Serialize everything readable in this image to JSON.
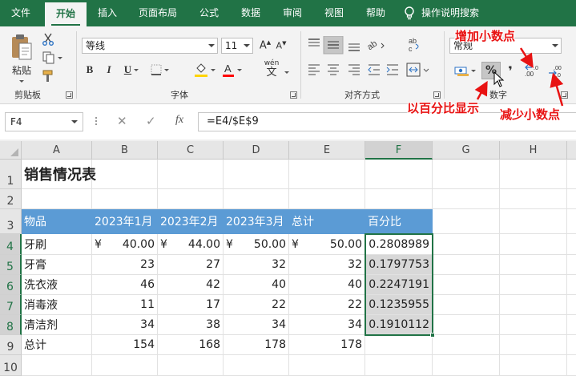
{
  "menu": {
    "tabs": [
      "文件",
      "开始",
      "插入",
      "页面布局",
      "公式",
      "数据",
      "审阅",
      "视图",
      "帮助"
    ],
    "active_tab": "开始",
    "tell_me": "操作说明搜索"
  },
  "ribbon": {
    "clipboard": {
      "paste_label": "粘贴",
      "group_label": "剪贴板"
    },
    "font": {
      "font_name": "等线",
      "font_size": "11",
      "wen_label": "wén",
      "group_label": "字体"
    },
    "alignment": {
      "group_label": "对齐方式"
    },
    "number": {
      "format": "常规",
      "percent_symbol": "%",
      "comma_symbol": "❜",
      "group_label": "数字"
    }
  },
  "annotations": {
    "increase_decimal": "增加小数点",
    "percent_style": "以百分比显示",
    "decrease_decimal": "减少小数点",
    "color": "#e81212"
  },
  "formula_bar": {
    "name_box": "F4",
    "cancel": "✕",
    "enter": "✓",
    "fx": "fx",
    "formula": "=E4/$E$9"
  },
  "sheet": {
    "columns": [
      "A",
      "B",
      "C",
      "D",
      "E",
      "F",
      "G",
      "H"
    ],
    "rows": [
      "1",
      "2",
      "3",
      "4",
      "5",
      "6",
      "7",
      "8",
      "9",
      "10"
    ],
    "title": "销售情况表",
    "headers": [
      "物品",
      "2023年1月",
      "2023年2月",
      "2023年3月",
      "总计",
      "百分比"
    ],
    "currency_symbol": "¥",
    "data": [
      {
        "item": "牙刷",
        "jan": "40.00",
        "feb": "44.00",
        "mar": "50.00",
        "total": "50.00",
        "pct": "0.2808989"
      },
      {
        "item": "牙膏",
        "jan": "23",
        "feb": "27",
        "mar": "32",
        "total": "32",
        "pct": "0.1797753"
      },
      {
        "item": "洗衣液",
        "jan": "46",
        "feb": "42",
        "mar": "40",
        "total": "40",
        "pct": "0.2247191"
      },
      {
        "item": "消毒液",
        "jan": "11",
        "feb": "17",
        "mar": "22",
        "total": "22",
        "pct": "0.1235955"
      },
      {
        "item": "清洁剂",
        "jan": "34",
        "feb": "38",
        "mar": "34",
        "total": "34",
        "pct": "0.1910112"
      }
    ],
    "totals": {
      "label": "总计",
      "jan": "154",
      "feb": "168",
      "mar": "178",
      "total": "178"
    },
    "header_fill": "#5b9bd5",
    "accent": "#217346"
  }
}
